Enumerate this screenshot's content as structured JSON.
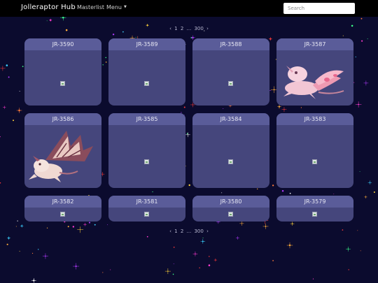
{
  "nav": {
    "brand": "Jolleraptor Hub",
    "masterlist": "Masterlist",
    "menu": "Menu",
    "search_placeholder": "Search"
  },
  "pagination_top": {
    "prev": "‹",
    "pages": [
      "1",
      "2",
      "...",
      "300"
    ],
    "next": "›"
  },
  "pagination_bottom": {
    "prev": "‹",
    "pages": [
      "1",
      "2",
      "...",
      "300"
    ],
    "next": "›"
  },
  "cards": [
    {
      "title": "JR-3590",
      "image": "broken-image-icon"
    },
    {
      "title": "JR-3589",
      "image": "broken-image-icon"
    },
    {
      "title": "JR-3588",
      "image": "broken-image-icon"
    },
    {
      "title": "JR-3587",
      "image": "pink-raptor-art"
    },
    {
      "title": "JR-3586",
      "image": "winged-raptor-art"
    },
    {
      "title": "JR-3585",
      "image": "broken-image-icon"
    },
    {
      "title": "JR-3584",
      "image": "broken-image-icon"
    },
    {
      "title": "JR-3583",
      "image": "broken-image-icon"
    },
    {
      "title": "JR-3582",
      "image": "broken-image-icon"
    },
    {
      "title": "JR-3581",
      "image": "broken-image-icon"
    },
    {
      "title": "JR-3580",
      "image": "broken-image-icon"
    },
    {
      "title": "JR-3579",
      "image": "broken-image-icon"
    }
  ],
  "colors": {
    "background": "#0b0b2e",
    "navbar": "#000000",
    "card_body": "#45467c",
    "card_header": "#5a5c99"
  }
}
